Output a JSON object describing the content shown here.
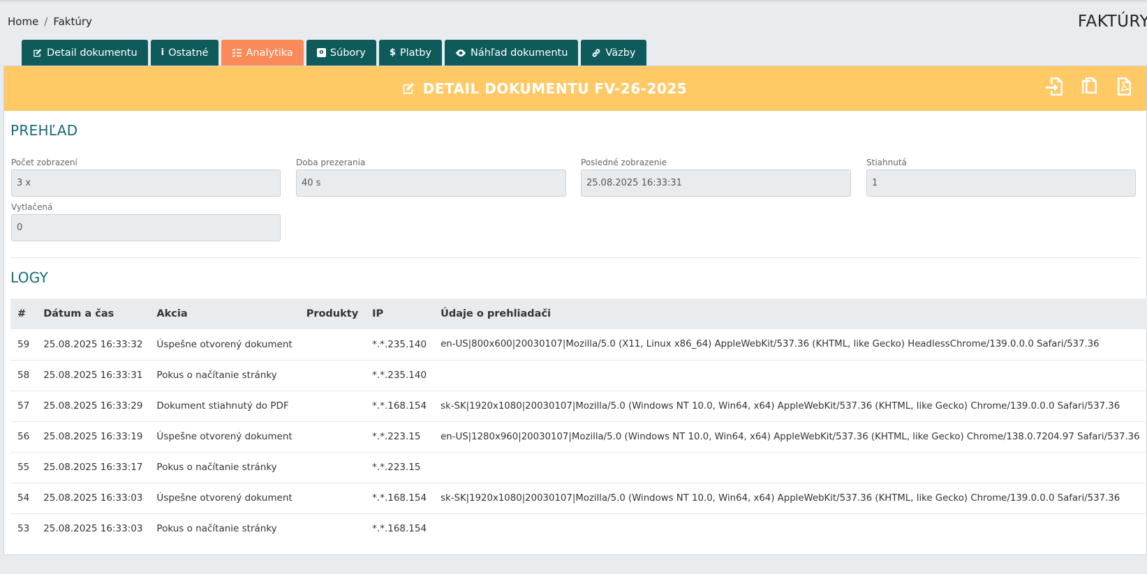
{
  "breadcrumb": {
    "home": "Home",
    "separator": "/",
    "current": "Faktúry"
  },
  "page_heading": "FAKTÚRY",
  "tabs": [
    {
      "label": "Detail dokumentu",
      "icon": "edit-icon",
      "active": false
    },
    {
      "label": "Ostatné",
      "icon": "info-icon",
      "active": false
    },
    {
      "label": "Analytika",
      "icon": "list-check-icon",
      "active": true
    },
    {
      "label": "Súbory",
      "icon": "file-box-icon",
      "active": false
    },
    {
      "label": "Platby",
      "icon": "dollar-icon",
      "active": false
    },
    {
      "label": "Náhľad dokumentu",
      "icon": "eye-icon",
      "active": false
    },
    {
      "label": "Väzby",
      "icon": "link-icon",
      "active": false
    }
  ],
  "card": {
    "title": "DETAIL DOKUMENTU FV-26-2025",
    "actions": [
      "import-icon",
      "copy-icon",
      "pdf-icon"
    ]
  },
  "overview": {
    "title": "PREHĽAD",
    "fields": {
      "views": {
        "label": "Počet zobrazení",
        "value": "3 x"
      },
      "duration": {
        "label": "Doba prezerania",
        "value": "40 s"
      },
      "last_view": {
        "label": "Posledné zobrazenie",
        "value": "25.08.2025 16:33:31"
      },
      "downloaded": {
        "label": "Stiahnutá",
        "value": "1"
      },
      "printed": {
        "label": "Vytlačená",
        "value": "0"
      }
    }
  },
  "logs": {
    "title": "LOGY",
    "columns": [
      "#",
      "Dátum a čas",
      "Akcia",
      "Produkty",
      "IP",
      "Údaje o prehliadači"
    ],
    "rows": [
      [
        "59",
        "25.08.2025 16:33:32",
        "Úspešne otvorený dokument",
        "",
        "*.*.235.140",
        "en-US|800x600|20030107|Mozilla/5.0 (X11, Linux x86_64) AppleWebKit/537.36 (KHTML, like Gecko) HeadlessChrome/139.0.0.0 Safari/537.36"
      ],
      [
        "58",
        "25.08.2025 16:33:31",
        "Pokus o načítanie stránky",
        "",
        "*.*.235.140",
        ""
      ],
      [
        "57",
        "25.08.2025 16:33:29",
        "Dokument stiahnutý do PDF",
        "",
        "*.*.168.154",
        "sk-SK|1920x1080|20030107|Mozilla/5.0 (Windows NT 10.0, Win64, x64) AppleWebKit/537.36 (KHTML, like Gecko) Chrome/139.0.0.0 Safari/537.36"
      ],
      [
        "56",
        "25.08.2025 16:33:19",
        "Úspešne otvorený dokument",
        "",
        "*.*.223.15",
        "en-US|1280x960|20030107|Mozilla/5.0 (Windows NT 10.0, Win64, x64) AppleWebKit/537.36 (KHTML, like Gecko) Chrome/138.0.7204.97 Safari/537.36"
      ],
      [
        "55",
        "25.08.2025 16:33:17",
        "Pokus o načítanie stránky",
        "",
        "*.*.223.15",
        ""
      ],
      [
        "54",
        "25.08.2025 16:33:03",
        "Úspešne otvorený dokument",
        "",
        "*.*.168.154",
        "sk-SK|1920x1080|20030107|Mozilla/5.0 (Windows NT 10.0, Win64, x64) AppleWebKit/537.36 (KHTML, like Gecko) Chrome/139.0.0.0 Safari/537.36"
      ],
      [
        "53",
        "25.08.2025 16:33:03",
        "Pokus o načítanie stránky",
        "",
        "*.*.168.154",
        ""
      ]
    ]
  },
  "colors": {
    "tab": "#0f5b5b",
    "tab_active": "#fa8a5a",
    "header": "#ffc966",
    "section_title": "#156a7a"
  }
}
